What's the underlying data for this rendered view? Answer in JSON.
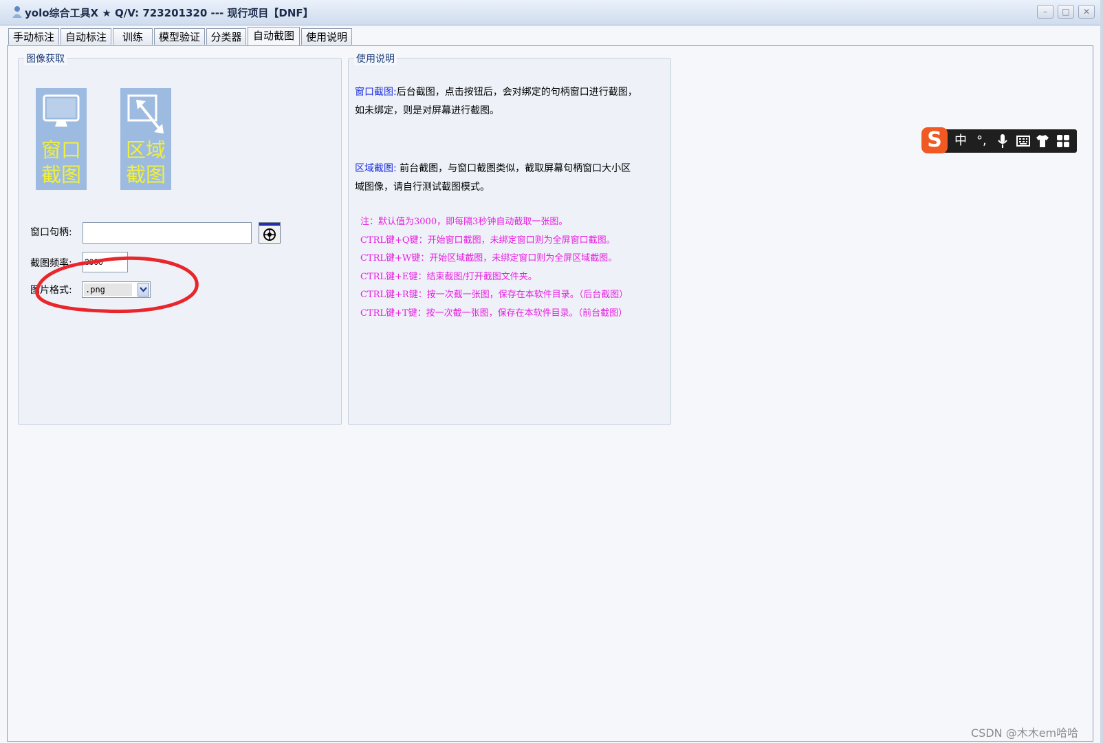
{
  "window": {
    "title": "yolo综合工具X ★ Q/V:  723201320 --- 现行项目【DNF】",
    "buttons": {
      "minimize": "–",
      "maximize": "□",
      "close": "✕"
    }
  },
  "tabs": [
    {
      "label": "手动标注"
    },
    {
      "label": "自动标注"
    },
    {
      "label": "训练"
    },
    {
      "label": "模型验证"
    },
    {
      "label": "分类器"
    },
    {
      "label": "自动截图"
    },
    {
      "label": "使用说明"
    }
  ],
  "active_tab": "自动截图",
  "capture_group": {
    "title": "图像获取",
    "window_capture_button": {
      "line1": "窗口",
      "line2": "截图",
      "icon": "monitor-icon"
    },
    "region_capture_button": {
      "line1": "区域",
      "line2": "截图",
      "icon": "region-select-icon"
    },
    "handle_label": "窗口句柄:",
    "handle_value": "",
    "handle_picker_icon": "crosshair-target-icon",
    "frequency_label": "截图频率:",
    "frequency_value": "3000",
    "format_label": "图片格式:",
    "format_value": ".png"
  },
  "help_group": {
    "title": "使用说明",
    "window_capture_key": "窗口截图:",
    "window_capture_text1": "后台截图，点击按钮后，会对绑定的句柄窗口进行截图，",
    "window_capture_text2": "如未绑定，则是对屏幕进行截图。",
    "region_capture_key": "区域截图:",
    "region_capture_text1": " 前台截图，与窗口截图类似，截取屏幕句柄窗口大小区",
    "region_capture_text2": "域图像，请自行测试截图模式。",
    "notes": [
      "注：默认值为3000，即每隔3秒钟自动截取一张图。",
      "CTRL键+Q键：开始窗口截图，未绑定窗口则为全屏窗口截图。",
      "CTRL键+W键：开始区域截图，未绑定窗口则为全屏区域截图。",
      "CTRL键+E键：结束截图/打开截图文件夹。",
      "CTRL键+R键：按一次截一张图，保存在本软件目录。（后台截图）",
      "CTRL键+T键：按一次截一张图，保存在本软件目录。（前台截图）"
    ]
  },
  "ime_toolbar": {
    "logo": "S",
    "mode": "中",
    "punct": "°,",
    "icons": [
      "microphone-icon",
      "keyboard-icon",
      "skin-shirt-icon",
      "toolbox-grid-icon"
    ]
  },
  "watermark": "CSDN @木木em哈哈",
  "annotation_color": "#e8262b"
}
